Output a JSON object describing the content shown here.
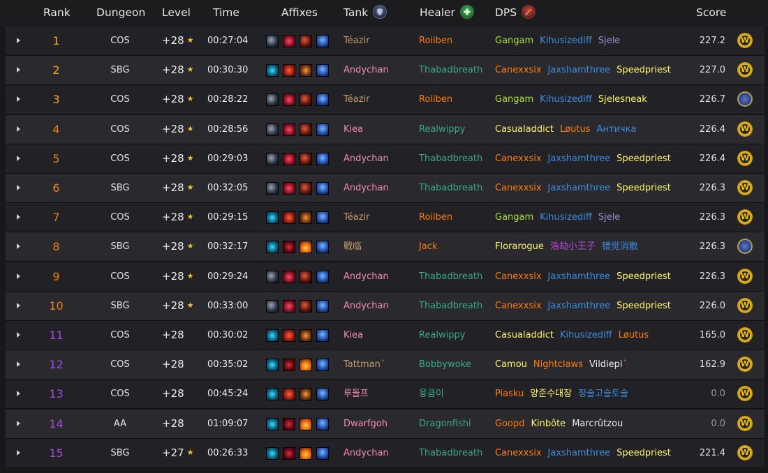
{
  "header": {
    "rank": "Rank",
    "dungeon": "Dungeon",
    "level": "Level",
    "time": "Time",
    "affixes": "Affixes",
    "tank": "Tank",
    "healer": "Healer",
    "dps": "DPS",
    "score": "Score"
  },
  "rows": [
    {
      "rank": "1",
      "dungeon": "COS",
      "level": "+28",
      "star": "★",
      "time": "00:27:04",
      "affix": "a",
      "tank": "Téazir",
      "tank_c": "c-tan",
      "healer": "Roiiben",
      "healer_c": "c-orange",
      "dps": [
        {
          "n": "Gangam",
          "c": "c-green"
        },
        {
          "n": "Kihusizediff",
          "c": "c-blue"
        },
        {
          "n": "Sjele",
          "c": "c-lavender"
        }
      ],
      "score": "227.2",
      "badge": "w"
    },
    {
      "rank": "2",
      "dungeon": "SBG",
      "level": "+28",
      "star": "★",
      "time": "00:30:30",
      "affix": "b",
      "tank": "Andychan",
      "tank_c": "c-pink",
      "healer": "Thabadbreath",
      "healer_c": "c-teal",
      "dps": [
        {
          "n": "Canexxsix",
          "c": "c-orange"
        },
        {
          "n": "Jaxshamthree",
          "c": "c-blue"
        },
        {
          "n": "Speedpriest",
          "c": "c-yellow"
        }
      ],
      "score": "227.0",
      "badge": "w"
    },
    {
      "rank": "3",
      "dungeon": "COS",
      "level": "+28",
      "star": "★",
      "time": "00:28:22",
      "affix": "a",
      "tank": "Téazir",
      "tank_c": "c-tan",
      "healer": "Roiiben",
      "healer_c": "c-orange",
      "dps": [
        {
          "n": "Gangam",
          "c": "c-green"
        },
        {
          "n": "Kihusizediff",
          "c": "c-blue"
        },
        {
          "n": "Sjelesneak",
          "c": "c-yellow"
        }
      ],
      "score": "226.7",
      "badge": "a"
    },
    {
      "rank": "4",
      "dungeon": "COS",
      "level": "+28",
      "star": "★",
      "time": "00:28:56",
      "affix": "a",
      "tank": "Kiea",
      "tank_c": "c-pink",
      "healer": "Realwippy",
      "healer_c": "c-teal",
      "dps": [
        {
          "n": "Casualaddict",
          "c": "c-yellow"
        },
        {
          "n": "Løutus",
          "c": "c-orange"
        },
        {
          "n": "Античка",
          "c": "c-blue"
        }
      ],
      "score": "226.4",
      "badge": "w"
    },
    {
      "rank": "5",
      "dungeon": "COS",
      "level": "+28",
      "star": "★",
      "time": "00:29:03",
      "affix": "a",
      "tank": "Andychan",
      "tank_c": "c-pink",
      "healer": "Thabadbreath",
      "healer_c": "c-teal",
      "dps": [
        {
          "n": "Canexxsix",
          "c": "c-orange"
        },
        {
          "n": "Jaxshamthree",
          "c": "c-blue"
        },
        {
          "n": "Speedpriest",
          "c": "c-yellow"
        }
      ],
      "score": "226.4",
      "badge": "w"
    },
    {
      "rank": "6",
      "dungeon": "SBG",
      "level": "+28",
      "star": "★",
      "time": "00:32:05",
      "affix": "a",
      "tank": "Andychan",
      "tank_c": "c-pink",
      "healer": "Thabadbreath",
      "healer_c": "c-teal",
      "dps": [
        {
          "n": "Canexxsix",
          "c": "c-orange"
        },
        {
          "n": "Jaxshamthree",
          "c": "c-blue"
        },
        {
          "n": "Speedpriest",
          "c": "c-yellow"
        }
      ],
      "score": "226.3",
      "badge": "w"
    },
    {
      "rank": "7",
      "dungeon": "COS",
      "level": "+28",
      "star": "★",
      "time": "00:29:15",
      "affix": "b",
      "tank": "Téazir",
      "tank_c": "c-tan",
      "healer": "Roiiben",
      "healer_c": "c-orange",
      "dps": [
        {
          "n": "Gangam",
          "c": "c-green"
        },
        {
          "n": "Kihusizediff",
          "c": "c-blue"
        },
        {
          "n": "Sjele",
          "c": "c-lavender"
        }
      ],
      "score": "226.3",
      "badge": "w"
    },
    {
      "rank": "8",
      "dungeon": "SBG",
      "level": "+28",
      "star": "★",
      "time": "00:32:17",
      "affix": "c",
      "tank": "戰临",
      "tank_c": "c-tan",
      "healer": "Jack",
      "healer_c": "c-orange",
      "dps": [
        {
          "n": "Florarogue",
          "c": "c-yellow"
        },
        {
          "n": "浩劫小王子",
          "c": "c-purple"
        },
        {
          "n": "错觉消散",
          "c": "c-blue"
        }
      ],
      "score": "226.3",
      "badge": "a"
    },
    {
      "rank": "9",
      "dungeon": "COS",
      "level": "+28",
      "star": "★",
      "time": "00:29:24",
      "affix": "a",
      "tank": "Andychan",
      "tank_c": "c-pink",
      "healer": "Thabadbreath",
      "healer_c": "c-teal",
      "dps": [
        {
          "n": "Canexxsix",
          "c": "c-orange"
        },
        {
          "n": "Jaxshamthree",
          "c": "c-blue"
        },
        {
          "n": "Speedpriest",
          "c": "c-yellow"
        }
      ],
      "score": "226.3",
      "badge": "w"
    },
    {
      "rank": "10",
      "dungeon": "SBG",
      "level": "+28",
      "star": "★",
      "time": "00:33:00",
      "affix": "a",
      "tank": "Andychan",
      "tank_c": "c-pink",
      "healer": "Thabadbreath",
      "healer_c": "c-teal",
      "dps": [
        {
          "n": "Canexxsix",
          "c": "c-orange"
        },
        {
          "n": "Jaxshamthree",
          "c": "c-blue"
        },
        {
          "n": "Speedpriest",
          "c": "c-yellow"
        }
      ],
      "score": "226.0",
      "badge": "w"
    },
    {
      "rank": "11",
      "dungeon": "COS",
      "level": "+28",
      "star": "",
      "time": "00:30:02",
      "affix": "b",
      "tank": "Kiea",
      "tank_c": "c-pink",
      "healer": "Realwippy",
      "healer_c": "c-teal",
      "dps": [
        {
          "n": "Casualaddict",
          "c": "c-yellow"
        },
        {
          "n": "Kihusizediff",
          "c": "c-blue"
        },
        {
          "n": "Løutus",
          "c": "c-orange"
        }
      ],
      "score": "165.0",
      "badge": "w"
    },
    {
      "rank": "12",
      "dungeon": "COS",
      "level": "+28",
      "star": "",
      "time": "00:35:02",
      "affix": "c",
      "tank": "Tattman",
      "tank_c": "c-tan",
      "tank_tick": "•",
      "healer": "Bobbywoke",
      "healer_c": "c-teal",
      "dps": [
        {
          "n": "Camou",
          "c": "c-yellow"
        },
        {
          "n": "Nightclaws",
          "c": "c-orange"
        },
        {
          "n": "Vildiepi",
          "c": "c-white",
          "tick": "•"
        }
      ],
      "score": "162.9",
      "badge": "w"
    },
    {
      "rank": "13",
      "dungeon": "COS",
      "level": "+28",
      "star": "",
      "time": "00:45:24",
      "affix": "b",
      "tank": "루돌프",
      "tank_c": "c-pink",
      "healer": "용큼이",
      "healer_c": "c-teal",
      "dps": [
        {
          "n": "Piasku",
          "c": "c-orange"
        },
        {
          "n": "양준수대장",
          "c": "c-yellow"
        },
        {
          "n": "정술고슬토술",
          "c": "c-blue"
        }
      ],
      "score": "0.0",
      "badge": "w"
    },
    {
      "rank": "14",
      "dungeon": "AA",
      "level": "+28",
      "star": "",
      "time": "01:09:07",
      "affix": "c",
      "tank": "Dwarfgoh",
      "tank_c": "c-pink",
      "healer": "Dragonfishi",
      "healer_c": "c-teal",
      "dps": [
        {
          "n": "Goopd",
          "c": "c-orange"
        },
        {
          "n": "Kinbôte",
          "c": "c-yellow"
        },
        {
          "n": "Marcrûtzou",
          "c": "c-white"
        }
      ],
      "score": "0.0",
      "badge": "w"
    },
    {
      "rank": "15",
      "dungeon": "SBG",
      "level": "+27",
      "star": "★",
      "time": "00:26:33",
      "affix": "c",
      "tank": "Andychan",
      "tank_c": "c-pink",
      "healer": "Thabadbreath",
      "healer_c": "c-teal",
      "dps": [
        {
          "n": "Canexxsix",
          "c": "c-orange"
        },
        {
          "n": "Jaxshamthree",
          "c": "c-blue"
        },
        {
          "n": "Speedpriest",
          "c": "c-yellow"
        }
      ],
      "score": "221.4",
      "badge": "w"
    }
  ],
  "icons": {
    "tank": "shield-icon",
    "healer": "plus-icon",
    "dps": "sword-icon",
    "expand": "chevron-right-icon",
    "faction_w": "horde-coin-icon",
    "faction_a": "alliance-crest-icon"
  }
}
